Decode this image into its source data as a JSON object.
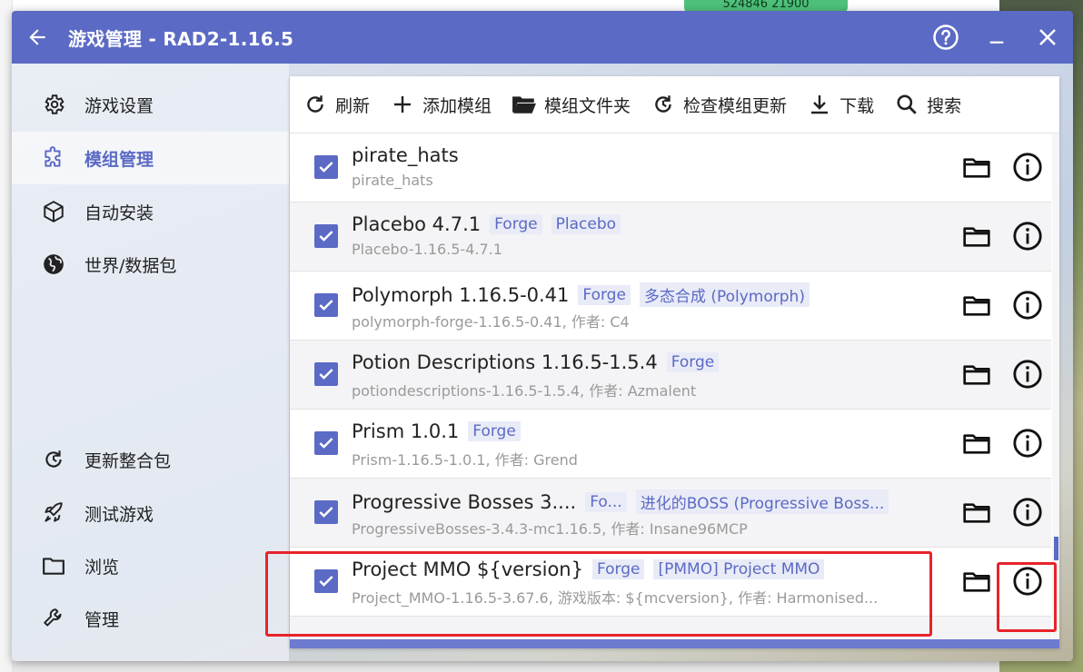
{
  "window": {
    "title": "游戏管理 - RAD2-1.16.5",
    "icons": [
      "back-arrow-icon",
      "help-icon",
      "minimize-icon",
      "close-icon"
    ]
  },
  "background": {
    "top_green_text": "524846 21900"
  },
  "sidebar": {
    "items": [
      {
        "label": "游戏设置",
        "icon": "gear-icon",
        "active": false
      },
      {
        "label": "模组管理",
        "icon": "puzzle-icon",
        "active": true
      },
      {
        "label": "自动安装",
        "icon": "cube-icon",
        "active": false
      },
      {
        "label": "世界/数据包",
        "icon": "globe-icon",
        "active": false
      },
      {
        "label": "更新整合包",
        "icon": "refresh-icon",
        "active": false
      },
      {
        "label": "测试游戏",
        "icon": "rocket-icon",
        "active": false
      },
      {
        "label": "浏览",
        "icon": "folder-icon",
        "active": false
      },
      {
        "label": "管理",
        "icon": "wrench-icon",
        "active": false
      }
    ]
  },
  "toolbar": {
    "items": [
      {
        "label": "刷新",
        "icon": "refresh-icon"
      },
      {
        "label": "添加模组",
        "icon": "plus-icon"
      },
      {
        "label": "模组文件夹",
        "icon": "folder-open-icon"
      },
      {
        "label": "检查模组更新",
        "icon": "update-check-icon"
      },
      {
        "label": "下载",
        "icon": "download-icon"
      },
      {
        "label": "搜索",
        "icon": "search-icon"
      }
    ]
  },
  "mods": [
    {
      "name": "pirate_hats",
      "tags": [],
      "file": "pirate_hats",
      "checked": true
    },
    {
      "name": "Placebo 4.7.1",
      "tags": [
        "Forge",
        "Placebo"
      ],
      "file": "Placebo-1.16.5-4.7.1",
      "checked": true
    },
    {
      "name": "Polymorph 1.16.5-0.41",
      "tags": [
        "Forge",
        "多态合成 (Polymorph)"
      ],
      "file": "polymorph-forge-1.16.5-0.41, 作者: C4",
      "checked": true
    },
    {
      "name": "Potion Descriptions 1.16.5-1.5.4",
      "tags": [
        "Forge"
      ],
      "file": "potiondescriptions-1.16.5-1.5.4, 作者: Azmalent",
      "checked": true
    },
    {
      "name": "Prism 1.0.1",
      "tags": [
        "Forge"
      ],
      "file": "Prism-1.16.5-1.0.1, 作者: Grend",
      "checked": true
    },
    {
      "name": "Progressive Bosses 3....",
      "tags": [
        "Fo...",
        "进化的BOSS (Progressive Boss..."
      ],
      "file": "ProgressiveBosses-3.4.3-mc1.16.5, 作者: Insane96MCP",
      "checked": true
    },
    {
      "name": "Project MMO ${version}",
      "tags": [
        "Forge",
        "[PMMO] Project MMO"
      ],
      "file": "Project_MMO-1.16.5-3.67.6, 游戏版本: ${mcversion}, 作者: Harmonised...",
      "checked": true
    }
  ],
  "colors": {
    "accent": "#5b6ac4",
    "highlight": "#e8232a"
  }
}
